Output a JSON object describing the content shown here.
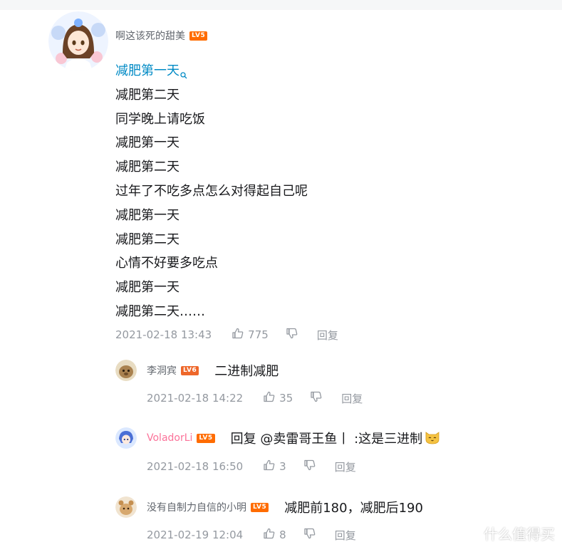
{
  "comment": {
    "username": "啊这该死的甜美",
    "level": "LV5",
    "lines": [
      "减肥第一天",
      "减肥第二天",
      "同学晚上请吃饭",
      "减肥第一天",
      "减肥第二天",
      "过年了不吃多点怎么对得起自己呢",
      "减肥第一天",
      "减肥第二天",
      "心情不好要多吃点",
      "减肥第一天",
      "减肥第二天……"
    ],
    "time": "2021-02-18 13:43",
    "likes": "775",
    "reply_label": "回复"
  },
  "replies": [
    {
      "username": "李洞宾",
      "level": "LV6",
      "text": "二进制减肥",
      "time": "2021-02-18 14:22",
      "likes": "35",
      "reply_label": "回复"
    },
    {
      "username": "VoladorLi",
      "level": "LV5",
      "text": "回复 @卖雷哥王鱼丨 :这是三进制",
      "emoji": "cat-emoji",
      "time": "2021-02-18 16:50",
      "likes": "3",
      "reply_label": "回复"
    },
    {
      "username": "没有自制力自信的小明",
      "level": "LV5",
      "text": "减肥前180，减肥后190",
      "time": "2021-02-19 12:04",
      "likes": "8",
      "reply_label": "回复"
    }
  ],
  "watermark": {
    "text": "什么值得买",
    "icon": "smzdm-logo-icon"
  },
  "colors": {
    "link": "#008ac5",
    "username": "#61666d",
    "vip_name": "#fb7299",
    "meta": "#9499a0",
    "lv5": "#ff6c00",
    "lv6": "#ee672a"
  }
}
